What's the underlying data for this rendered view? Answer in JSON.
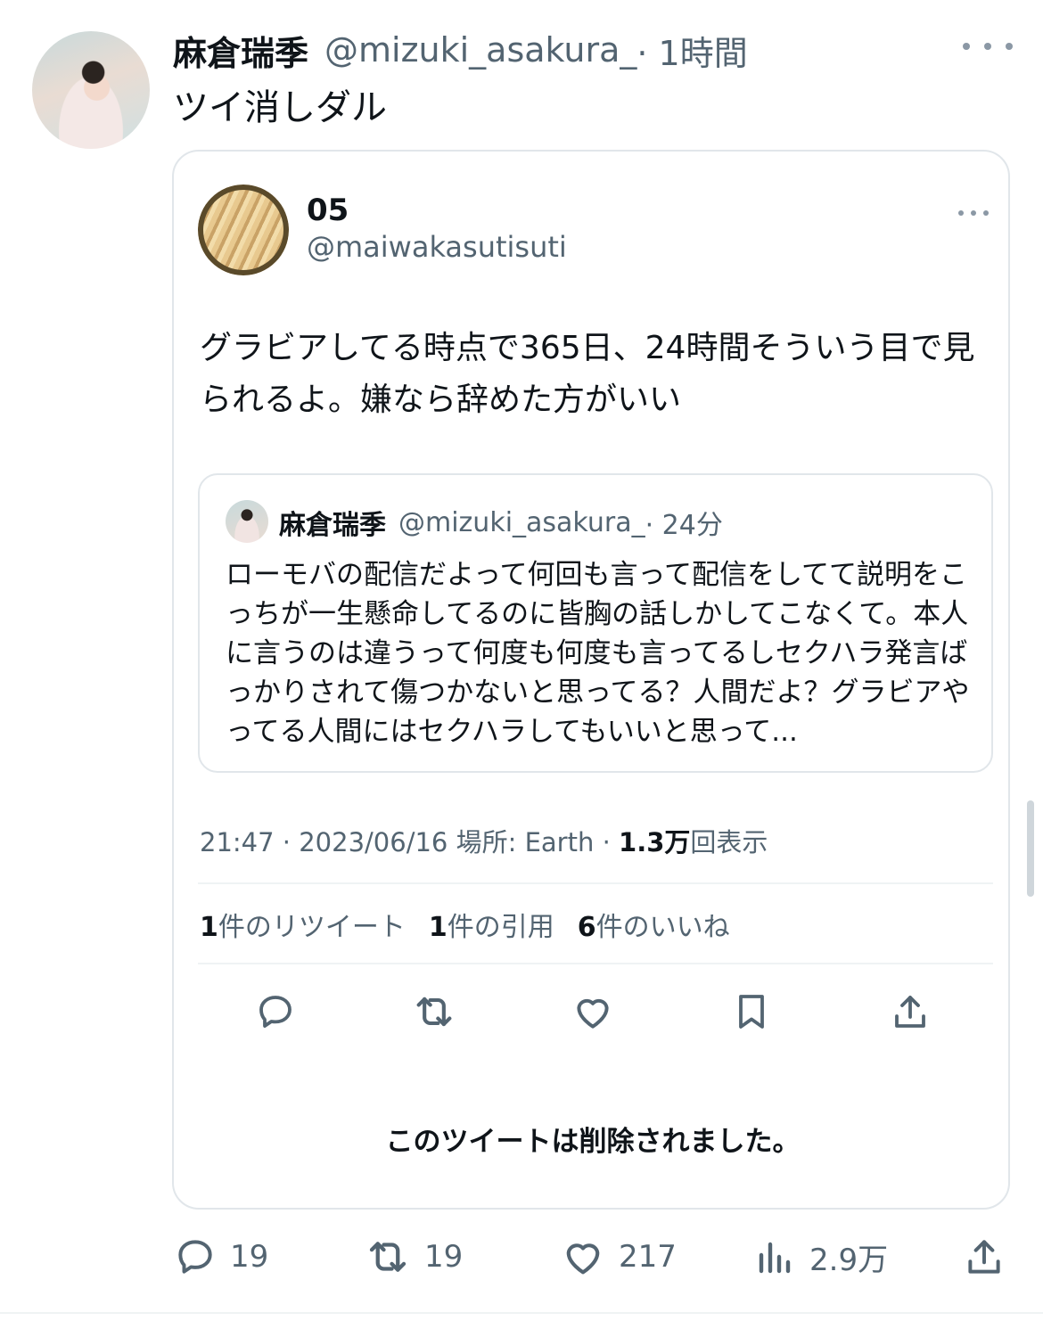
{
  "tweet": {
    "author_name": "麻倉瑞季",
    "author_handle": "@mizuki_asakura_",
    "time": "· 1時間",
    "text": "ツイ消しダル",
    "quoted": {
      "author_name": "05",
      "author_handle": "@maiwakasutisuti",
      "text": "グラビアしてる時点で365日、24時間そういう目で見られるよ。嫌なら辞めた方がいい",
      "inner_quote": {
        "author_name": "麻倉瑞季",
        "author_handle": "@mizuki_asakura_",
        "time": "· 24分",
        "text": "ローモバの配信だよって何回も言って配信をしてて説明をこっちが一生懸命してるのに皆胸の話しかしてこなくて。本人に言うのは違うって何度も何度も言ってるしセクハラ発言ばっかりされて傷つかないと思ってる？人間だよ？グラビアやってる人間にはセクハラしてもいいと思って..."
      },
      "meta": {
        "timestamp": "21:47 · 2023/06/16 場所: Earth ·",
        "views_value": "1.3万",
        "views_label": "回表示"
      },
      "stats": {
        "retweets_value": "1",
        "retweets_label": "件のリツイート",
        "quotes_value": "1",
        "quotes_label": "件の引用",
        "likes_value": "6",
        "likes_label": "件のいいね"
      },
      "deleted_notice": "このツイートは削除されました。"
    },
    "actions": {
      "replies": "19",
      "retweets": "19",
      "likes": "217",
      "views": "2.9万"
    }
  },
  "icons": [
    "more-icon",
    "reply-icon",
    "retweet-icon",
    "like-icon",
    "bookmark-icon",
    "share-icon",
    "views-icon"
  ],
  "colors": {
    "text": "#0f1419",
    "secondary": "#536471",
    "border": "#e1e6ea"
  }
}
